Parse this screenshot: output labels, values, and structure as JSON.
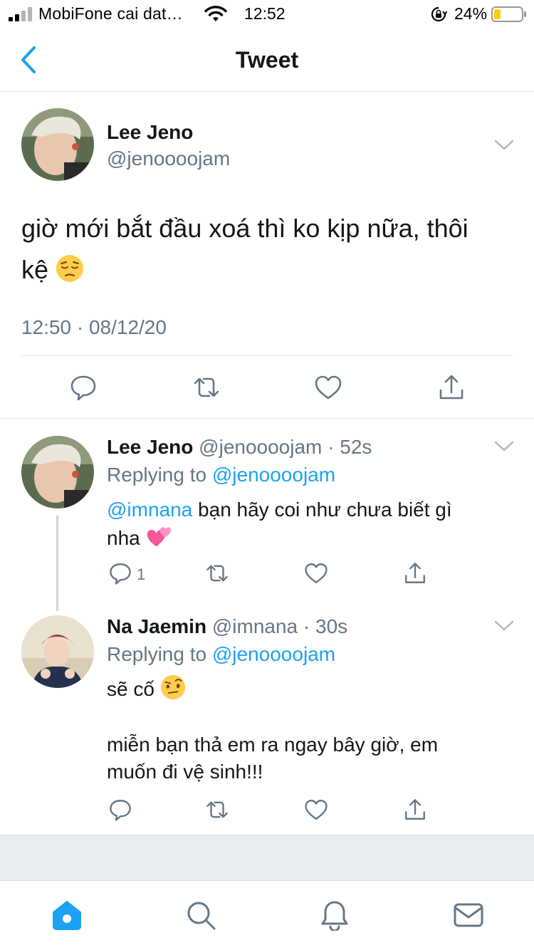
{
  "status_bar": {
    "carrier": "MobiFone cai dat…",
    "time": "12:52",
    "battery_percent": "24%",
    "battery_level": 0.24,
    "icons": [
      "signal-icon",
      "wifi-icon",
      "rotation-lock-icon",
      "battery-icon"
    ]
  },
  "header": {
    "title": "Tweet",
    "back_icon": "chevron-left-icon"
  },
  "main_tweet": {
    "name": "Lee Jeno",
    "handle": "@jenoooojam",
    "text_line1": "giờ mới bắt đầu xoá thì ko kịp nữa, thôi",
    "text_line2": "kệ",
    "emoji": "pensive-face",
    "timestamp": "12:50 · 08/12/20",
    "actions": [
      "reply-icon",
      "retweet-icon",
      "like-icon",
      "share-icon"
    ]
  },
  "replies": [
    {
      "name": "Lee Jeno",
      "handle": "@jenoooojam · 52s",
      "replying_prefix": "Replying to",
      "replying_to": "@jenoooojam",
      "mention": "@imnana",
      "text_line1": " bạn hãy coi như chưa biết gì",
      "text_line2": "nha",
      "emoji": "two-hearts",
      "reply_count": "1"
    },
    {
      "name": "Na Jaemin",
      "handle": "@imnana · 30s",
      "replying_prefix": "Replying to",
      "replying_to": "@jenoooojam",
      "text_line1": "sẽ cố",
      "emoji": "face-with-raised-eyebrow",
      "text_line2": "miễn bạn thả em ra ngay bây giờ, em",
      "text_line3": "muốn đi vệ sinh!!!"
    }
  ],
  "tab_bar": {
    "tabs": [
      "home-icon",
      "search-icon",
      "notifications-icon",
      "messages-icon"
    ],
    "active": "home-icon"
  },
  "colors": {
    "accent": "#1da1f2",
    "text_primary": "#14171a",
    "text_secondary": "#657786",
    "divider": "#e1e8ed",
    "battery_low": "#ffcc00"
  }
}
